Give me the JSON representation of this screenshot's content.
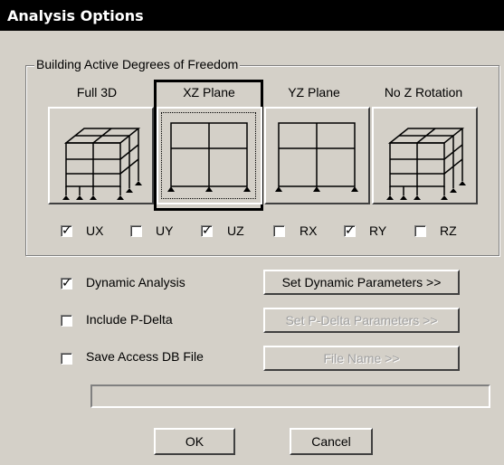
{
  "window": {
    "title": "Analysis Options"
  },
  "dof_group": {
    "label": "Building Active Degrees of Freedom",
    "planes": [
      {
        "label": "Full 3D",
        "icon": "3d-frame-icon",
        "selected": false
      },
      {
        "label": "XZ Plane",
        "icon": "2d-frame-icon",
        "selected": true
      },
      {
        "label": "YZ Plane",
        "icon": "2d-frame-icon",
        "selected": false
      },
      {
        "label": "No Z Rotation",
        "icon": "3d-frame-icon",
        "selected": false
      }
    ],
    "dofs": [
      {
        "label": "UX",
        "checked": true
      },
      {
        "label": "UY",
        "checked": false
      },
      {
        "label": "UZ",
        "checked": true
      },
      {
        "label": "RX",
        "checked": false
      },
      {
        "label": "RY",
        "checked": true
      },
      {
        "label": "RZ",
        "checked": false
      }
    ]
  },
  "options": {
    "dynamic": {
      "label": "Dynamic Analysis",
      "checked": true,
      "button": "Set Dynamic Parameters >>",
      "button_enabled": true
    },
    "pdelta": {
      "label": "Include P-Delta",
      "checked": false,
      "button": "Set P-Delta Parameters >>",
      "button_enabled": false
    },
    "access": {
      "label": "Save Access DB File",
      "checked": false,
      "button": "File Name >>",
      "button_enabled": false
    },
    "filename_value": ""
  },
  "buttons": {
    "ok": "OK",
    "cancel": "Cancel"
  }
}
